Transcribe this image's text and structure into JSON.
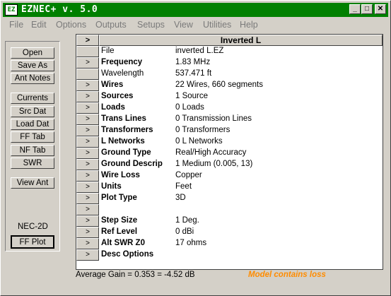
{
  "window": {
    "title": "EZNEC+  v. 5.0",
    "icon_label": "EZ",
    "controls": {
      "minimize": "_",
      "maximize": "□",
      "close": "✕"
    }
  },
  "menu": [
    "File",
    "Edit",
    "Options",
    "Outputs",
    "Setups",
    "View",
    "Utilities",
    "Help"
  ],
  "left_buttons": {
    "open": "Open",
    "save_as": "Save As",
    "ant_notes": "Ant Notes",
    "currents": "Currents",
    "src_dat": "Src Dat",
    "load_dat": "Load Dat",
    "ff_tab": "FF Tab",
    "nf_tab": "NF Tab",
    "swr": "SWR",
    "view_ant": "View Ant",
    "engine_label": "NEC-2D",
    "ff_plot": "FF Plot"
  },
  "grid": {
    "header_arrow": ">",
    "header_title": "Inverted L",
    "row_arrow": ">",
    "rows": [
      {
        "label": "File",
        "value": "inverted L.EZ",
        "bold": false,
        "button": false
      },
      {
        "label": "Frequency",
        "value": "1.83 MHz",
        "bold": true,
        "button": true
      },
      {
        "label": "Wavelength",
        "value": "537.471 ft",
        "bold": false,
        "button": false
      },
      {
        "label": "Wires",
        "value": "22 Wires, 660 segments",
        "bold": true,
        "button": true
      },
      {
        "label": "Sources",
        "value": "1 Source",
        "bold": true,
        "button": true
      },
      {
        "label": "Loads",
        "value": "0 Loads",
        "bold": true,
        "button": true
      },
      {
        "label": "Trans Lines",
        "value": "0 Transmission Lines",
        "bold": true,
        "button": true
      },
      {
        "label": "Transformers",
        "value": "0 Transformers",
        "bold": true,
        "button": true
      },
      {
        "label": "L Networks",
        "value": "0 L Networks",
        "bold": true,
        "button": true
      },
      {
        "label": "Ground Type",
        "value": "Real/High Accuracy",
        "bold": true,
        "button": true
      },
      {
        "label": "Ground Descrip",
        "value": "1 Medium (0.005, 13)",
        "bold": true,
        "button": true
      },
      {
        "label": "Wire Loss",
        "value": "Copper",
        "bold": true,
        "button": true
      },
      {
        "label": "Units",
        "value": "Feet",
        "bold": true,
        "button": true
      },
      {
        "label": "Plot Type",
        "value": "3D",
        "bold": true,
        "button": true
      },
      {
        "label": "",
        "value": "",
        "bold": false,
        "button": true
      },
      {
        "label": "Step Size",
        "value": "1 Deg.",
        "bold": true,
        "button": true
      },
      {
        "label": "Ref Level",
        "value": "0 dBi",
        "bold": true,
        "button": true
      },
      {
        "label": "Alt SWR Z0",
        "value": "17 ohms",
        "bold": true,
        "button": true
      },
      {
        "label": "Desc Options",
        "value": "",
        "bold": true,
        "button": true
      }
    ]
  },
  "status": {
    "average_gain": "Average Gain = 0.353 = -4.52 dB",
    "loss_note": "Model contains loss"
  }
}
